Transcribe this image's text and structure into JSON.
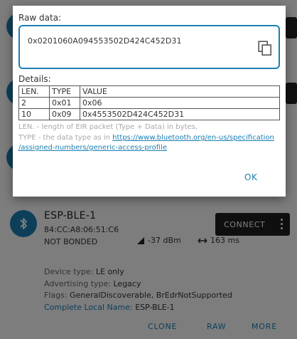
{
  "device": {
    "name": "ESP-BLE-1",
    "mac": "84:CC:A8:06:51:C6",
    "bond_state": "NOT BONDED",
    "rssi": "-37 dBm",
    "interval": "163 ms",
    "connect_label": "CONNECT",
    "device_type_label": "Device type:",
    "device_type_value": "LE only",
    "advertising_type_label": "Advertising type:",
    "advertising_type_value": "Legacy",
    "flags_label": "Flags:",
    "flags_value": "GeneralDiscoverable, BrEdrNotSupported",
    "local_name_label": "Complete Local Name:",
    "local_name_value": "ESP-BLE-1"
  },
  "actions": {
    "clone": "CLONE",
    "raw": "RAW",
    "more": "MORE"
  },
  "dialog": {
    "raw_label": "Raw data:",
    "raw_value": "0x0201060A094553502D424C452D31",
    "details_label": "Details:",
    "columns": [
      "LEN.",
      "TYPE",
      "VALUE"
    ],
    "rows": [
      [
        "2",
        "0x01",
        "0x06"
      ],
      [
        "10",
        "0x09",
        "0x4553502D424C452D31"
      ]
    ],
    "note_len": "LEN. - length of EIR packet (Type + Data) in bytes,",
    "note_type_prefix": "TYPE - the data type as in ",
    "note_link_1": "https://www.bluetooth.org/en-us/specification",
    "note_link_2": "/assigned-numbers/generic-access-profile",
    "ok_label": "OK"
  },
  "colors": {
    "accent": "#1b7fb3",
    "connect_bg": "#1f1f1f"
  }
}
